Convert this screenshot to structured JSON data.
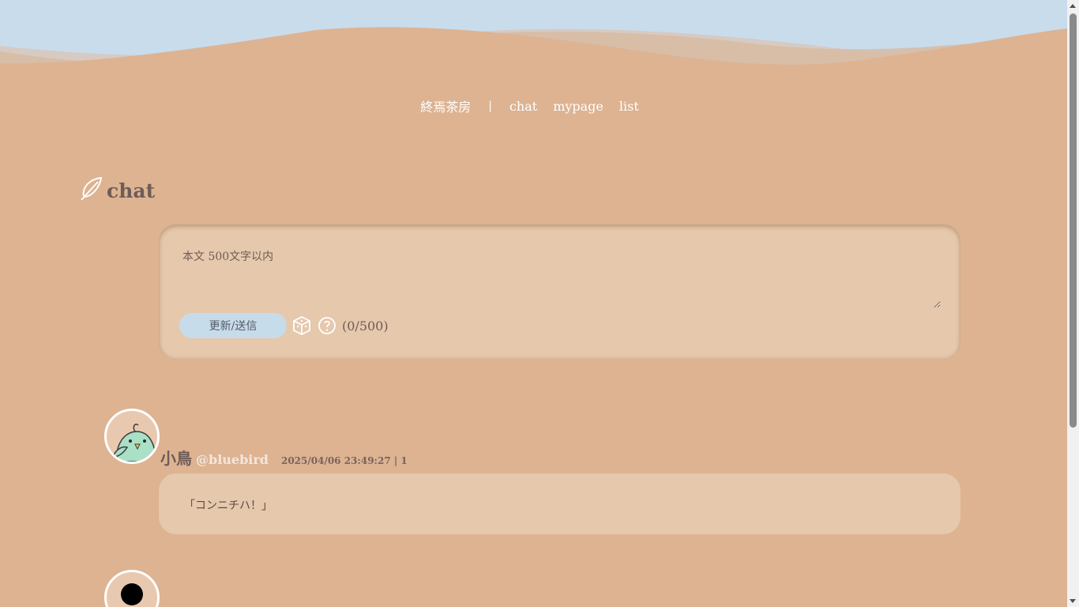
{
  "nav": {
    "site_name": "終焉茶房",
    "separator": "|",
    "links": [
      "chat",
      "mypage",
      "list"
    ]
  },
  "page_title": "chat",
  "compose": {
    "placeholder": "本文 500文字以内",
    "send_label": "更新/送信",
    "counter": "(0/500)"
  },
  "posts": [
    {
      "author_name": "小鳥",
      "author_handle": "@bluebird",
      "meta": "2025/04/06 23:49:27 | 1",
      "body": "「コンニチハ！」",
      "avatar_icon": "bird-avatar-icon"
    }
  ],
  "icons": {
    "title": "feather-icon",
    "dice": "dice-icon",
    "help": "help-circle-icon",
    "second_avatar": "user-silhouette-icon"
  },
  "colors": {
    "background": "#ddb392",
    "panel": "#e6c8ac",
    "sky": "#c7dcea",
    "text": "#6e5c57",
    "button": "#c7dcea"
  }
}
